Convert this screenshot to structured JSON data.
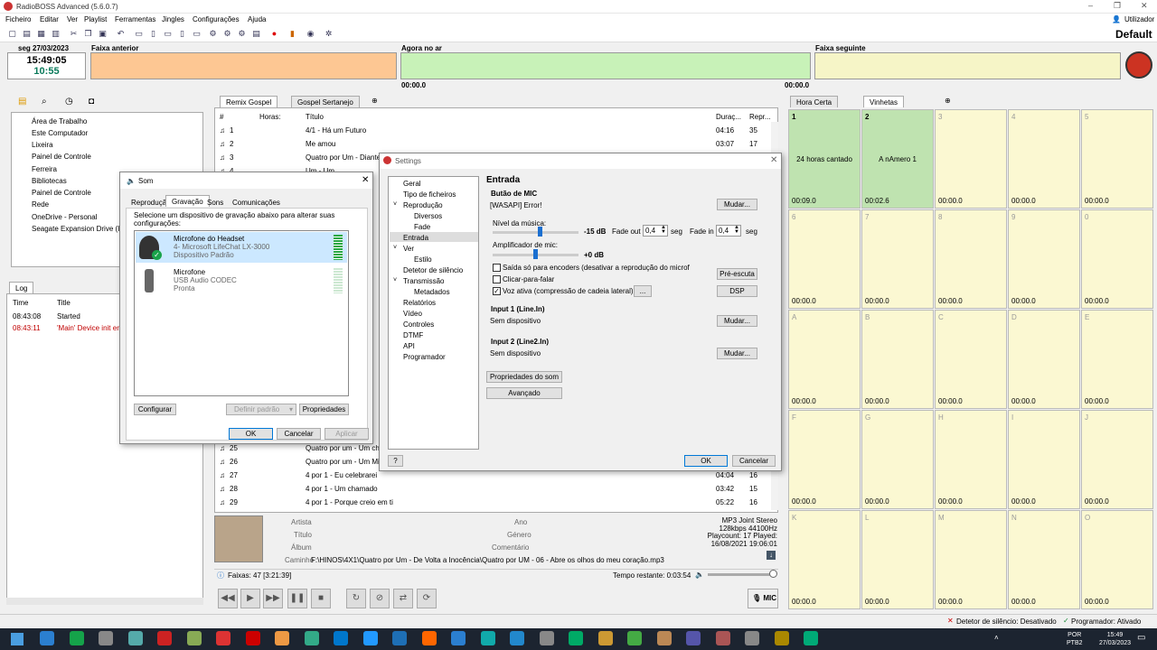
{
  "window": {
    "title": "RadioBOSS Advanced (5.6.0.7)",
    "user_label": "Utilizador",
    "profile": "Default"
  },
  "menu": [
    "Ficheiro",
    "Editar",
    "Ver",
    "Playlist",
    "Ferramentas",
    "Jingles",
    "Configurações",
    "Ajuda"
  ],
  "header": {
    "date": "seg 27/03/2023",
    "time": "15:49:05",
    "remaining": "10:55",
    "prev_label": "Faixa anterior",
    "now_label": "Agora no ar",
    "next_label": "Faixa seguinte",
    "now_time_left": "00:00.0",
    "now_time_right": "00:00.0"
  },
  "library": {
    "tree": [
      "Área de Trabalho",
      "Este Computador",
      "Lixeira",
      "Painel de Controle",
      "Ferreira",
      "Bibliotecas",
      "Painel de Controle",
      "Rede",
      "OneDrive - Personal",
      "Seagate Expansion Drive (I"
    ]
  },
  "log": {
    "tab": "Log",
    "col_time": "Time",
    "col_title": "Title",
    "rows": [
      {
        "time": "08:43:08",
        "title": "Started",
        "color": "#000000"
      },
      {
        "time": "08:43:11",
        "title": "'Main' Device init err",
        "color": "#c00000"
      }
    ]
  },
  "playlist": {
    "tabs": [
      "Remix Gospel",
      "Gospel Sertanejo"
    ],
    "cols": {
      "num": "#",
      "hours": "Horas:",
      "title": "Título",
      "dur": "Duraç...",
      "rep": "Repr..."
    },
    "rows": [
      {
        "num": "1",
        "title": "4/1 - Há um Futuro",
        "dur": "04:16",
        "rep": "35"
      },
      {
        "num": "2",
        "title": "Me amou",
        "dur": "03:07",
        "rep": "17"
      },
      {
        "num": "3",
        "title": "Quatro por Um - Diante",
        "dur": "",
        "rep": ""
      },
      {
        "num": "4",
        "title": "Um - Um",
        "dur": "",
        "rep": ""
      }
    ],
    "rows_bottom": [
      {
        "num": "25",
        "title": "Quatro por um - Um ch",
        "dur": "",
        "rep": ""
      },
      {
        "num": "26",
        "title": "Quatro por um - Um Mi",
        "dur": "",
        "rep": ""
      },
      {
        "num": "27",
        "title": "4 por 1 - Eu celebrarei",
        "dur": "04:04",
        "rep": "16"
      },
      {
        "num": "28",
        "title": "4 por 1 - Um chamado",
        "dur": "03:42",
        "rep": "15"
      },
      {
        "num": "29",
        "title": "4 por 1 - Porque creio em ti",
        "dur": "05:22",
        "rep": "16"
      }
    ],
    "info": {
      "artist_label": "Artista",
      "title_label": "Título",
      "album_label": "Álbum",
      "path_label": "Caminho",
      "year_label": "Ano",
      "genre_label": "Género",
      "comment_label": "Comentário",
      "format": "MP3 Joint Stereo",
      "bitrate": "128kbps 44100Hz",
      "playcount": "Playcount: 17  Played:",
      "played_date": "16/08/2021 19:06:01",
      "path": "F:\\HINOS\\4X1\\Quatro por Um - De Volta a Inocência\\Quatro por UM - 06 - Abre os olhos do meu coração.mp3"
    },
    "status": "Faixas: 47 [3:21:39]",
    "time_left": "Tempo restante: 0:03:54",
    "mic_label": "MIC"
  },
  "grid": {
    "tabs": [
      "Hora Certa",
      "Vinhetas"
    ],
    "cells": [
      {
        "key": "1",
        "title": "24 horas cantado",
        "time": "00:09.0",
        "active": true
      },
      {
        "key": "2",
        "title": "A nAmero 1",
        "time": "00:02.6",
        "active": true
      },
      {
        "key": "3",
        "title": "",
        "time": "00:00.0",
        "active": false
      },
      {
        "key": "4",
        "title": "",
        "time": "00:00.0",
        "active": false
      },
      {
        "key": "5",
        "title": "",
        "time": "00:00.0",
        "active": false
      },
      {
        "key": "6",
        "title": "",
        "time": "00:00.0",
        "active": false
      },
      {
        "key": "7",
        "title": "",
        "time": "00:00.0",
        "active": false
      },
      {
        "key": "8",
        "title": "",
        "time": "00:00.0",
        "active": false
      },
      {
        "key": "9",
        "title": "",
        "time": "00:00.0",
        "active": false
      },
      {
        "key": "0",
        "title": "",
        "time": "00:00.0",
        "active": false
      },
      {
        "key": "A",
        "title": "",
        "time": "00:00.0",
        "active": false
      },
      {
        "key": "B",
        "title": "",
        "time": "00:00.0",
        "active": false
      },
      {
        "key": "C",
        "title": "",
        "time": "00:00.0",
        "active": false
      },
      {
        "key": "D",
        "title": "",
        "time": "00:00.0",
        "active": false
      },
      {
        "key": "E",
        "title": "",
        "time": "00:00.0",
        "active": false
      },
      {
        "key": "F",
        "title": "",
        "time": "00:00.0",
        "active": false
      },
      {
        "key": "G",
        "title": "",
        "time": "00:00.0",
        "active": false
      },
      {
        "key": "H",
        "title": "",
        "time": "00:00.0",
        "active": false
      },
      {
        "key": "I",
        "title": "",
        "time": "00:00.0",
        "active": false
      },
      {
        "key": "J",
        "title": "",
        "time": "00:00.0",
        "active": false
      },
      {
        "key": "K",
        "title": "",
        "time": "00:00.0",
        "active": false
      },
      {
        "key": "L",
        "title": "",
        "time": "00:00.0",
        "active": false
      },
      {
        "key": "M",
        "title": "",
        "time": "00:00.0",
        "active": false
      },
      {
        "key": "N",
        "title": "",
        "time": "00:00.0",
        "active": false
      },
      {
        "key": "O",
        "title": "",
        "time": "00:00.0",
        "active": false
      }
    ]
  },
  "som": {
    "title": "Som",
    "tabs": [
      "Reprodução",
      "Gravação",
      "Sons",
      "Comunicações"
    ],
    "instruction": "Selecione um dispositivo de gravação abaixo para alterar suas configurações:",
    "devices": [
      {
        "name": "Microfone do Headset",
        "sub1": "4- Microsoft LifeChat LX-3000",
        "sub2": "Dispositivo Padrão"
      },
      {
        "name": "Microfone",
        "sub1": "USB Audio CODEC",
        "sub2": "Pronta"
      }
    ],
    "configure": "Configurar",
    "set_default": "Definir padrão",
    "properties": "Propriedades",
    "ok": "OK",
    "cancel": "Cancelar",
    "apply": "Aplicar"
  },
  "settings": {
    "title": "Settings",
    "nav": [
      "Geral",
      "Tipo de ficheiros",
      "Reprodução",
      "Diversos",
      "Fade",
      "Entrada",
      "Ver",
      "Estilo",
      "Detetor de silêncio",
      "Transmissão",
      "Metadados",
      "Relatórios",
      "Vídeo",
      "Controles",
      "DTMF",
      "API",
      "Programador"
    ],
    "section": "Entrada",
    "mic_group": "Butão de MIC",
    "mic_status": "[WASAPI] Error!",
    "change": "Mudar...",
    "music_level_label": "Nível da música:",
    "music_level": "-15 dB",
    "music_level_pct": 0.55,
    "fade_out_label": "Fade out",
    "fade_out": "0,4",
    "fade_in_label": "Fade in",
    "fade_in": "0,4",
    "seg": "seg",
    "mic_amp_label": "Amplificador de mic:",
    "mic_amp": "+0 dB",
    "mic_amp_pct": 0.5,
    "chk_encoders": "Saída só para encoders (desativar a reprodução do microfo",
    "chk_click": "Clicar-para-falar",
    "chk_voice": "Voz ativa (compressão de cadeia lateral)",
    "prelisten": "Pré-escuta",
    "dsp": "DSP",
    "dots": "...",
    "input1_group": "Input 1 (Line.In)",
    "input1_status": "Sem dispositivo",
    "input2_group": "Input 2 (Line2.In)",
    "input2_status": "Sem dispositivo",
    "sound_props": "Propriedades do som",
    "advanced": "Avançado",
    "help": "?",
    "ok": "OK",
    "cancel": "Cancelar"
  },
  "statusbar": {
    "silence": "Detetor de silêncio: Desativado",
    "scheduler": "Programador: Ativado"
  },
  "taskbar": {
    "lang1": "POR",
    "lang2": "PTB2",
    "time": "15:49",
    "date": "27/03/2023"
  }
}
